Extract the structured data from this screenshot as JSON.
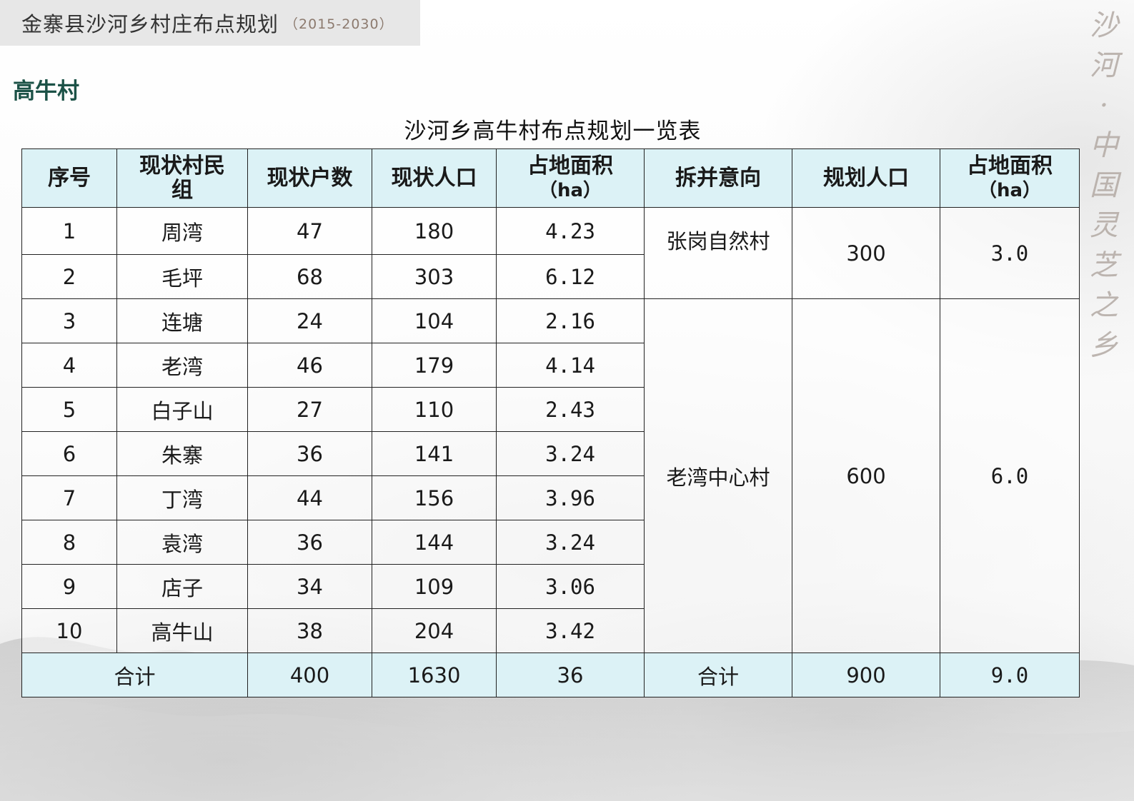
{
  "header": {
    "title": "金寨县沙河乡村庄布点规划",
    "years": "（2015-2030）"
  },
  "section_title": "高牛村",
  "slogan_chars": [
    "沙",
    "河",
    "·",
    "中",
    "国",
    "灵",
    "芝",
    "之",
    "乡"
  ],
  "table": {
    "caption": "沙河乡高牛村布点规划一览表",
    "headers": {
      "seq": "序号",
      "group_line1": "现状村民",
      "group_line2": "组",
      "households": "现状户数",
      "population": "现状人口",
      "area_line1": "占地面积",
      "area_line2": "（ha）",
      "merge": "拆并意向",
      "plan_pop": "规划人口",
      "plan_area_line1": "占地面积",
      "plan_area_line2": "（ha）"
    },
    "rows": [
      {
        "seq": "1",
        "group": "周湾",
        "households": "47",
        "population": "180",
        "area": "4.23"
      },
      {
        "seq": "2",
        "group": "毛坪",
        "households": "68",
        "population": "303",
        "area": "6.12"
      },
      {
        "seq": "3",
        "group": "连塘",
        "households": "24",
        "population": "104",
        "area": "2.16"
      },
      {
        "seq": "4",
        "group": "老湾",
        "households": "46",
        "population": "179",
        "area": "4.14"
      },
      {
        "seq": "5",
        "group": "白子山",
        "households": "27",
        "population": "110",
        "area": "2.43"
      },
      {
        "seq": "6",
        "group": "朱寨",
        "households": "36",
        "population": "141",
        "area": "3.24"
      },
      {
        "seq": "7",
        "group": "丁湾",
        "households": "44",
        "population": "156",
        "area": "3.96"
      },
      {
        "seq": "8",
        "group": "袁湾",
        "households": "36",
        "population": "144",
        "area": "3.24"
      },
      {
        "seq": "9",
        "group": "店子",
        "households": "34",
        "population": "109",
        "area": "3.06"
      },
      {
        "seq": "10",
        "group": "高牛山",
        "households": "38",
        "population": "204",
        "area": "3.42"
      }
    ],
    "plans": [
      {
        "merge": "张岗自然村",
        "plan_pop": "300",
        "plan_area": "3.0"
      },
      {
        "merge": "老湾中心村",
        "plan_pop": "600",
        "plan_area": "6.0"
      }
    ],
    "totals": {
      "label": "合计",
      "households": "400",
      "population": "1630",
      "area": "36",
      "merge_label": "合计",
      "plan_pop": "900",
      "plan_area": "9.0"
    }
  },
  "colors": {
    "header_bg": "#e7e7e7",
    "section_title": "#1c5247",
    "table_header_bg": "#dcf2f6",
    "border": "#222222"
  }
}
